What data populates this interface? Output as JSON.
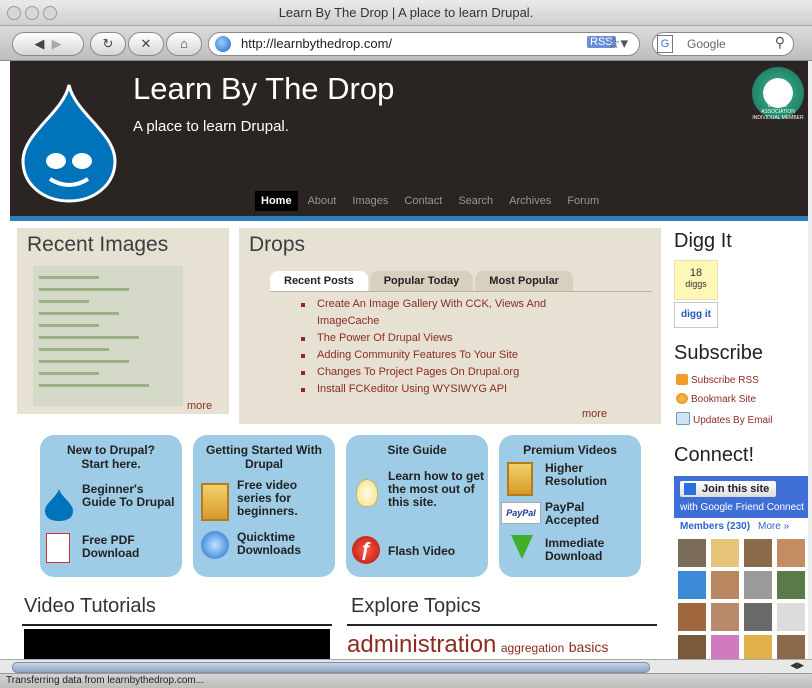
{
  "window": {
    "title": "Learn By The Drop | A place to learn Drupal."
  },
  "toolbar": {
    "back_icon": "back-icon",
    "url": "http://learnbythedrop.com/",
    "search_placeholder": "Google",
    "search_engine_letter": "G"
  },
  "site": {
    "title": "Learn By The Drop",
    "slogan": "A place to learn Drupal.",
    "badge_text": "DRUPAL ASSOCIATION INDIVIDUAL MEMBER"
  },
  "nav": [
    "Home",
    "About",
    "Images",
    "Contact",
    "Search",
    "Archives",
    "Forum"
  ],
  "recent_images": {
    "title": "Recent Images",
    "more": "more"
  },
  "drops": {
    "title": "Drops",
    "tabs": [
      "Recent Posts",
      "Popular Today",
      "Most Popular"
    ],
    "posts": [
      "Create An Image Gallery With CCK, Views And ImageCache",
      "The Power Of Drupal Views",
      "Adding Community Features To Your Site",
      "Changes To Project Pages On Drupal.org",
      "Install FCKeditor Using WYSIWYG API"
    ],
    "more": "more"
  },
  "digg": {
    "title": "Digg It",
    "count": "18",
    "count_label": "diggs",
    "button": "digg it"
  },
  "subscribe": {
    "title": "Subscribe",
    "items": [
      "Subscribe RSS",
      "Bookmark Site",
      "Updates By Email"
    ]
  },
  "connect": {
    "title": "Connect!",
    "join": "Join this site",
    "join_sub": "with Google Friend Connect",
    "members": "Members (230)",
    "more": "More »"
  },
  "cards": [
    {
      "title": "New to Drupal? Start here.",
      "line1": "Beginner's Guide To Drupal",
      "line2": "Free PDF Download"
    },
    {
      "title": "Getting Started With Drupal",
      "line1": "Free video series for beginners.",
      "line2": "Quicktime Downloads"
    },
    {
      "title": "Site Guide",
      "line1": "Learn how to get the most out of this site.",
      "line2": "Flash Video"
    },
    {
      "title": "Premium Videos",
      "line1": "Higher Resolution",
      "line2": "PayPal Accepted",
      "line3": "Immediate Download",
      "paypal": "PayPal"
    }
  ],
  "sections": {
    "video": "Video Tutorials",
    "explore": "Explore Topics"
  },
  "tags": [
    "administration",
    "aggregation",
    "basics"
  ],
  "status": "Transferring data from learnbythedrop.com...",
  "colors": {
    "header_bg": "#2a2522",
    "link": "#8c2c20",
    "card_bg": "#9ecbe5",
    "panel_bg": "#e6e1d3"
  }
}
